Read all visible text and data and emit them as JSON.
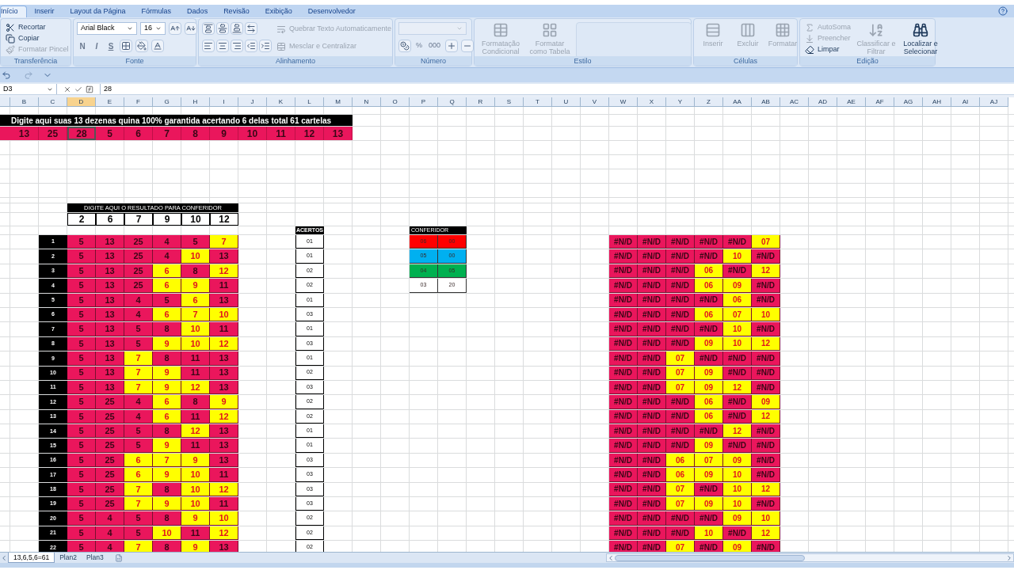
{
  "ribbon": {
    "tabs": [
      {
        "label": "Início",
        "selected": true
      },
      {
        "label": "Inserir",
        "selected": false
      },
      {
        "label": "Layout da Página",
        "selected": false
      },
      {
        "label": "Fórmulas",
        "selected": false
      },
      {
        "label": "Dados",
        "selected": false
      },
      {
        "label": "Revisão",
        "selected": false
      },
      {
        "label": "Exibição",
        "selected": false
      },
      {
        "label": "Desenvolvedor",
        "selected": false
      }
    ],
    "groups": [
      {
        "kind": "clipboard",
        "label": "Transferência",
        "items": [
          {
            "label": "Recortar",
            "disabled": false
          },
          {
            "label": "Copiar",
            "disabled": false
          },
          {
            "label": "Formatar Pincel",
            "disabled": true
          }
        ]
      },
      {
        "kind": "font",
        "label": "Fonte",
        "font": "Arial Black",
        "size": "16",
        "items": [
          {
            "label": "N",
            "disabled": true
          },
          {
            "label": "I",
            "disabled": true
          },
          {
            "label": "S",
            "disabled": true
          }
        ]
      },
      {
        "kind": "align",
        "label": "Alinhamento",
        "items": [
          {
            "label": "Quebrar Texto Automaticamente",
            "disabled": true
          },
          {
            "label": "Mesclar e Centralizar",
            "disabled": true
          }
        ]
      },
      {
        "kind": "number",
        "label": "Número",
        "items": [
          {
            "label": "%",
            "disabled": true
          },
          {
            "label": "000",
            "disabled": true
          }
        ]
      },
      {
        "kind": "style",
        "label": "Estilo",
        "items": [
          {
            "label": "Formatação Condicional",
            "disabled": true
          },
          {
            "label": "Formatar como Tabela",
            "disabled": true
          }
        ]
      },
      {
        "kind": "cells",
        "label": "Células",
        "items": [
          {
            "label": "Inserir",
            "disabled": true
          },
          {
            "label": "Excluir",
            "disabled": true
          },
          {
            "label": "Formatar",
            "disabled": true
          }
        ]
      },
      {
        "kind": "edit",
        "label": "Edição",
        "items": [
          {
            "label": "AutoSoma",
            "disabled": true
          },
          {
            "label": "Preencher",
            "disabled": true
          },
          {
            "label": "Limpar",
            "disabled": false
          },
          {
            "label": "Classificar e Filtrar",
            "disabled": true
          },
          {
            "label": "Localizar e Selecionar",
            "disabled": false
          }
        ]
      }
    ]
  },
  "formula_bar": {
    "name_box": "D3",
    "formula": "28"
  },
  "column_headers": [
    {
      "label": "B",
      "selected": false
    },
    {
      "label": "C",
      "selected": false
    },
    {
      "label": "D",
      "selected": true
    },
    {
      "label": "E",
      "selected": false
    },
    {
      "label": "F",
      "selected": false
    },
    {
      "label": "G",
      "selected": false
    },
    {
      "label": "H",
      "selected": false
    },
    {
      "label": "I",
      "selected": false
    },
    {
      "label": "J",
      "selected": false
    },
    {
      "label": "K",
      "selected": false
    },
    {
      "label": "L",
      "selected": false
    },
    {
      "label": "M",
      "selected": false
    },
    {
      "label": "N",
      "selected": false
    },
    {
      "label": "O",
      "selected": false
    },
    {
      "label": "P",
      "selected": false
    },
    {
      "label": "Q",
      "selected": false
    },
    {
      "label": "R",
      "selected": false
    },
    {
      "label": "S",
      "selected": false
    },
    {
      "label": "T",
      "selected": false
    },
    {
      "label": "U",
      "selected": false
    },
    {
      "label": "V",
      "selected": false
    },
    {
      "label": "W",
      "selected": false
    },
    {
      "label": "X",
      "selected": false
    },
    {
      "label": "Y",
      "selected": false
    },
    {
      "label": "Z",
      "selected": false
    },
    {
      "label": "AA",
      "selected": false
    },
    {
      "label": "AB",
      "selected": false
    },
    {
      "label": "AC",
      "selected": false
    },
    {
      "label": "AD",
      "selected": false
    },
    {
      "label": "AE",
      "selected": false
    },
    {
      "label": "AF",
      "selected": false
    },
    {
      "label": "AG",
      "selected": false
    },
    {
      "label": "AH",
      "selected": false
    },
    {
      "label": "AI",
      "selected": false
    },
    {
      "label": "AJ",
      "selected": false
    }
  ],
  "sheet": {
    "title": "Digite aqui suas 13 dezenas quina 100% garantida acertando 6 delas total 61 cartelas",
    "top_numbers": [
      {
        "value": "13",
        "selected": false
      },
      {
        "value": "25",
        "selected": false
      },
      {
        "value": "28",
        "selected": true
      },
      {
        "value": "5",
        "selected": false
      },
      {
        "value": "6",
        "selected": false
      },
      {
        "value": "7",
        "selected": false
      },
      {
        "value": "8",
        "selected": false
      },
      {
        "value": "9",
        "selected": false
      },
      {
        "value": "10",
        "selected": false
      },
      {
        "value": "11",
        "selected": false
      },
      {
        "value": "12",
        "selected": false
      },
      {
        "value": "13",
        "selected": false
      }
    ],
    "result_header": "DIGITE AQUI O RESULTADO PARA CONFERIDOR",
    "result_numbers": [
      "2",
      "6",
      "7",
      "9",
      "10",
      "12"
    ],
    "acertos_header": "ACERTOS",
    "conferidor": {
      "title": "CONFERIDOR",
      "rows": [
        {
          "values": [
            "06",
            "00"
          ],
          "color": "#ff0000"
        },
        {
          "values": [
            "05",
            "00"
          ],
          "color": "#00b0f0"
        },
        {
          "values": [
            "04",
            "05"
          ],
          "color": "#00b050"
        },
        {
          "values": [
            "03",
            "20"
          ],
          "color": "#ffffff"
        }
      ]
    },
    "rows": [
      {
        "index": "1",
        "acertos": "01",
        "cells": [
          {
            "value": "5",
            "hit": false
          },
          {
            "value": "13",
            "hit": false
          },
          {
            "value": "25",
            "hit": false
          },
          {
            "value": "4",
            "hit": false
          },
          {
            "value": "5",
            "hit": false
          },
          {
            "value": "7",
            "hit": true
          }
        ],
        "check": [
          {
            "value": "#N/D",
            "hit": false
          },
          {
            "value": "#N/D",
            "hit": false
          },
          {
            "value": "#N/D",
            "hit": false
          },
          {
            "value": "#N/D",
            "hit": false
          },
          {
            "value": "#N/D",
            "hit": false
          },
          {
            "value": "07",
            "hit": true
          }
        ]
      },
      {
        "index": "2",
        "acertos": "01",
        "cells": [
          {
            "value": "5",
            "hit": false
          },
          {
            "value": "13",
            "hit": false
          },
          {
            "value": "25",
            "hit": false
          },
          {
            "value": "4",
            "hit": false
          },
          {
            "value": "10",
            "hit": true
          },
          {
            "value": "13",
            "hit": false
          }
        ],
        "check": [
          {
            "value": "#N/D",
            "hit": false
          },
          {
            "value": "#N/D",
            "hit": false
          },
          {
            "value": "#N/D",
            "hit": false
          },
          {
            "value": "#N/D",
            "hit": false
          },
          {
            "value": "10",
            "hit": true
          },
          {
            "value": "#N/D",
            "hit": false
          }
        ]
      },
      {
        "index": "3",
        "acertos": "02",
        "cells": [
          {
            "value": "5",
            "hit": false
          },
          {
            "value": "13",
            "hit": false
          },
          {
            "value": "25",
            "hit": false
          },
          {
            "value": "6",
            "hit": true
          },
          {
            "value": "8",
            "hit": false
          },
          {
            "value": "12",
            "hit": true
          }
        ],
        "check": [
          {
            "value": "#N/D",
            "hit": false
          },
          {
            "value": "#N/D",
            "hit": false
          },
          {
            "value": "#N/D",
            "hit": false
          },
          {
            "value": "06",
            "hit": true
          },
          {
            "value": "#N/D",
            "hit": false
          },
          {
            "value": "12",
            "hit": true
          }
        ]
      },
      {
        "index": "4",
        "acertos": "02",
        "cells": [
          {
            "value": "5",
            "hit": false
          },
          {
            "value": "13",
            "hit": false
          },
          {
            "value": "25",
            "hit": false
          },
          {
            "value": "6",
            "hit": true
          },
          {
            "value": "9",
            "hit": true
          },
          {
            "value": "11",
            "hit": false
          }
        ],
        "check": [
          {
            "value": "#N/D",
            "hit": false
          },
          {
            "value": "#N/D",
            "hit": false
          },
          {
            "value": "#N/D",
            "hit": false
          },
          {
            "value": "06",
            "hit": true
          },
          {
            "value": "09",
            "hit": true
          },
          {
            "value": "#N/D",
            "hit": false
          }
        ]
      },
      {
        "index": "5",
        "acertos": "01",
        "cells": [
          {
            "value": "5",
            "hit": false
          },
          {
            "value": "13",
            "hit": false
          },
          {
            "value": "4",
            "hit": false
          },
          {
            "value": "5",
            "hit": false
          },
          {
            "value": "6",
            "hit": true
          },
          {
            "value": "13",
            "hit": false
          }
        ],
        "check": [
          {
            "value": "#N/D",
            "hit": false
          },
          {
            "value": "#N/D",
            "hit": false
          },
          {
            "value": "#N/D",
            "hit": false
          },
          {
            "value": "#N/D",
            "hit": false
          },
          {
            "value": "06",
            "hit": true
          },
          {
            "value": "#N/D",
            "hit": false
          }
        ]
      },
      {
        "index": "6",
        "acertos": "03",
        "cells": [
          {
            "value": "5",
            "hit": false
          },
          {
            "value": "13",
            "hit": false
          },
          {
            "value": "4",
            "hit": false
          },
          {
            "value": "6",
            "hit": true
          },
          {
            "value": "7",
            "hit": true
          },
          {
            "value": "10",
            "hit": true
          }
        ],
        "check": [
          {
            "value": "#N/D",
            "hit": false
          },
          {
            "value": "#N/D",
            "hit": false
          },
          {
            "value": "#N/D",
            "hit": false
          },
          {
            "value": "06",
            "hit": true
          },
          {
            "value": "07",
            "hit": true
          },
          {
            "value": "10",
            "hit": true
          }
        ]
      },
      {
        "index": "7",
        "acertos": "01",
        "cells": [
          {
            "value": "5",
            "hit": false
          },
          {
            "value": "13",
            "hit": false
          },
          {
            "value": "5",
            "hit": false
          },
          {
            "value": "8",
            "hit": false
          },
          {
            "value": "10",
            "hit": true
          },
          {
            "value": "11",
            "hit": false
          }
        ],
        "check": [
          {
            "value": "#N/D",
            "hit": false
          },
          {
            "value": "#N/D",
            "hit": false
          },
          {
            "value": "#N/D",
            "hit": false
          },
          {
            "value": "#N/D",
            "hit": false
          },
          {
            "value": "10",
            "hit": true
          },
          {
            "value": "#N/D",
            "hit": false
          }
        ]
      },
      {
        "index": "8",
        "acertos": "03",
        "cells": [
          {
            "value": "5",
            "hit": false
          },
          {
            "value": "13",
            "hit": false
          },
          {
            "value": "5",
            "hit": false
          },
          {
            "value": "9",
            "hit": true
          },
          {
            "value": "10",
            "hit": true
          },
          {
            "value": "12",
            "hit": true
          }
        ],
        "check": [
          {
            "value": "#N/D",
            "hit": false
          },
          {
            "value": "#N/D",
            "hit": false
          },
          {
            "value": "#N/D",
            "hit": false
          },
          {
            "value": "09",
            "hit": true
          },
          {
            "value": "10",
            "hit": true
          },
          {
            "value": "12",
            "hit": true
          }
        ]
      },
      {
        "index": "9",
        "acertos": "01",
        "cells": [
          {
            "value": "5",
            "hit": false
          },
          {
            "value": "13",
            "hit": false
          },
          {
            "value": "7",
            "hit": true
          },
          {
            "value": "8",
            "hit": false
          },
          {
            "value": "11",
            "hit": false
          },
          {
            "value": "13",
            "hit": false
          }
        ],
        "check": [
          {
            "value": "#N/D",
            "hit": false
          },
          {
            "value": "#N/D",
            "hit": false
          },
          {
            "value": "07",
            "hit": true
          },
          {
            "value": "#N/D",
            "hit": false
          },
          {
            "value": "#N/D",
            "hit": false
          },
          {
            "value": "#N/D",
            "hit": false
          }
        ]
      },
      {
        "index": "10",
        "acertos": "02",
        "cells": [
          {
            "value": "5",
            "hit": false
          },
          {
            "value": "13",
            "hit": false
          },
          {
            "value": "7",
            "hit": true
          },
          {
            "value": "9",
            "hit": true
          },
          {
            "value": "11",
            "hit": false
          },
          {
            "value": "13",
            "hit": false
          }
        ],
        "check": [
          {
            "value": "#N/D",
            "hit": false
          },
          {
            "value": "#N/D",
            "hit": false
          },
          {
            "value": "07",
            "hit": true
          },
          {
            "value": "09",
            "hit": true
          },
          {
            "value": "#N/D",
            "hit": false
          },
          {
            "value": "#N/D",
            "hit": false
          }
        ]
      },
      {
        "index": "11",
        "acertos": "03",
        "cells": [
          {
            "value": "5",
            "hit": false
          },
          {
            "value": "13",
            "hit": false
          },
          {
            "value": "7",
            "hit": true
          },
          {
            "value": "9",
            "hit": true
          },
          {
            "value": "12",
            "hit": true
          },
          {
            "value": "13",
            "hit": false
          }
        ],
        "check": [
          {
            "value": "#N/D",
            "hit": false
          },
          {
            "value": "#N/D",
            "hit": false
          },
          {
            "value": "07",
            "hit": true
          },
          {
            "value": "09",
            "hit": true
          },
          {
            "value": "12",
            "hit": true
          },
          {
            "value": "#N/D",
            "hit": false
          }
        ]
      },
      {
        "index": "12",
        "acertos": "02",
        "cells": [
          {
            "value": "5",
            "hit": false
          },
          {
            "value": "25",
            "hit": false
          },
          {
            "value": "4",
            "hit": false
          },
          {
            "value": "6",
            "hit": true
          },
          {
            "value": "8",
            "hit": false
          },
          {
            "value": "9",
            "hit": true
          }
        ],
        "check": [
          {
            "value": "#N/D",
            "hit": false
          },
          {
            "value": "#N/D",
            "hit": false
          },
          {
            "value": "#N/D",
            "hit": false
          },
          {
            "value": "06",
            "hit": true
          },
          {
            "value": "#N/D",
            "hit": false
          },
          {
            "value": "09",
            "hit": true
          }
        ]
      },
      {
        "index": "13",
        "acertos": "02",
        "cells": [
          {
            "value": "5",
            "hit": false
          },
          {
            "value": "25",
            "hit": false
          },
          {
            "value": "4",
            "hit": false
          },
          {
            "value": "6",
            "hit": true
          },
          {
            "value": "11",
            "hit": false
          },
          {
            "value": "12",
            "hit": true
          }
        ],
        "check": [
          {
            "value": "#N/D",
            "hit": false
          },
          {
            "value": "#N/D",
            "hit": false
          },
          {
            "value": "#N/D",
            "hit": false
          },
          {
            "value": "06",
            "hit": true
          },
          {
            "value": "#N/D",
            "hit": false
          },
          {
            "value": "12",
            "hit": true
          }
        ]
      },
      {
        "index": "14",
        "acertos": "01",
        "cells": [
          {
            "value": "5",
            "hit": false
          },
          {
            "value": "25",
            "hit": false
          },
          {
            "value": "5",
            "hit": false
          },
          {
            "value": "8",
            "hit": false
          },
          {
            "value": "12",
            "hit": true
          },
          {
            "value": "13",
            "hit": false
          }
        ],
        "check": [
          {
            "value": "#N/D",
            "hit": false
          },
          {
            "value": "#N/D",
            "hit": false
          },
          {
            "value": "#N/D",
            "hit": false
          },
          {
            "value": "#N/D",
            "hit": false
          },
          {
            "value": "12",
            "hit": true
          },
          {
            "value": "#N/D",
            "hit": false
          }
        ]
      },
      {
        "index": "15",
        "acertos": "01",
        "cells": [
          {
            "value": "5",
            "hit": false
          },
          {
            "value": "25",
            "hit": false
          },
          {
            "value": "5",
            "hit": false
          },
          {
            "value": "9",
            "hit": true
          },
          {
            "value": "11",
            "hit": false
          },
          {
            "value": "13",
            "hit": false
          }
        ],
        "check": [
          {
            "value": "#N/D",
            "hit": false
          },
          {
            "value": "#N/D",
            "hit": false
          },
          {
            "value": "#N/D",
            "hit": false
          },
          {
            "value": "09",
            "hit": true
          },
          {
            "value": "#N/D",
            "hit": false
          },
          {
            "value": "#N/D",
            "hit": false
          }
        ]
      },
      {
        "index": "16",
        "acertos": "03",
        "cells": [
          {
            "value": "5",
            "hit": false
          },
          {
            "value": "25",
            "hit": false
          },
          {
            "value": "6",
            "hit": true
          },
          {
            "value": "7",
            "hit": true
          },
          {
            "value": "9",
            "hit": true
          },
          {
            "value": "13",
            "hit": false
          }
        ],
        "check": [
          {
            "value": "#N/D",
            "hit": false
          },
          {
            "value": "#N/D",
            "hit": false
          },
          {
            "value": "06",
            "hit": true
          },
          {
            "value": "07",
            "hit": true
          },
          {
            "value": "09",
            "hit": true
          },
          {
            "value": "#N/D",
            "hit": false
          }
        ]
      },
      {
        "index": "17",
        "acertos": "03",
        "cells": [
          {
            "value": "5",
            "hit": false
          },
          {
            "value": "25",
            "hit": false
          },
          {
            "value": "6",
            "hit": true
          },
          {
            "value": "9",
            "hit": true
          },
          {
            "value": "10",
            "hit": true
          },
          {
            "value": "11",
            "hit": false
          }
        ],
        "check": [
          {
            "value": "#N/D",
            "hit": false
          },
          {
            "value": "#N/D",
            "hit": false
          },
          {
            "value": "06",
            "hit": true
          },
          {
            "value": "09",
            "hit": true
          },
          {
            "value": "10",
            "hit": true
          },
          {
            "value": "#N/D",
            "hit": false
          }
        ]
      },
      {
        "index": "18",
        "acertos": "03",
        "cells": [
          {
            "value": "5",
            "hit": false
          },
          {
            "value": "25",
            "hit": false
          },
          {
            "value": "7",
            "hit": true
          },
          {
            "value": "8",
            "hit": false
          },
          {
            "value": "10",
            "hit": true
          },
          {
            "value": "12",
            "hit": true
          }
        ],
        "check": [
          {
            "value": "#N/D",
            "hit": false
          },
          {
            "value": "#N/D",
            "hit": false
          },
          {
            "value": "07",
            "hit": true
          },
          {
            "value": "#N/D",
            "hit": false
          },
          {
            "value": "10",
            "hit": true
          },
          {
            "value": "12",
            "hit": true
          }
        ]
      },
      {
        "index": "19",
        "acertos": "03",
        "cells": [
          {
            "value": "5",
            "hit": false
          },
          {
            "value": "25",
            "hit": false
          },
          {
            "value": "7",
            "hit": true
          },
          {
            "value": "9",
            "hit": true
          },
          {
            "value": "10",
            "hit": true
          },
          {
            "value": "11",
            "hit": false
          }
        ],
        "check": [
          {
            "value": "#N/D",
            "hit": false
          },
          {
            "value": "#N/D",
            "hit": false
          },
          {
            "value": "07",
            "hit": true
          },
          {
            "value": "09",
            "hit": true
          },
          {
            "value": "10",
            "hit": true
          },
          {
            "value": "#N/D",
            "hit": false
          }
        ]
      },
      {
        "index": "20",
        "acertos": "02",
        "cells": [
          {
            "value": "5",
            "hit": false
          },
          {
            "value": "4",
            "hit": false
          },
          {
            "value": "5",
            "hit": false
          },
          {
            "value": "8",
            "hit": false
          },
          {
            "value": "9",
            "hit": true
          },
          {
            "value": "10",
            "hit": true
          }
        ],
        "check": [
          {
            "value": "#N/D",
            "hit": false
          },
          {
            "value": "#N/D",
            "hit": false
          },
          {
            "value": "#N/D",
            "hit": false
          },
          {
            "value": "#N/D",
            "hit": false
          },
          {
            "value": "09",
            "hit": true
          },
          {
            "value": "10",
            "hit": true
          }
        ]
      },
      {
        "index": "21",
        "acertos": "02",
        "cells": [
          {
            "value": "5",
            "hit": false
          },
          {
            "value": "4",
            "hit": false
          },
          {
            "value": "5",
            "hit": false
          },
          {
            "value": "10",
            "hit": true
          },
          {
            "value": "11",
            "hit": false
          },
          {
            "value": "12",
            "hit": true
          }
        ],
        "check": [
          {
            "value": "#N/D",
            "hit": false
          },
          {
            "value": "#N/D",
            "hit": false
          },
          {
            "value": "#N/D",
            "hit": false
          },
          {
            "value": "10",
            "hit": true
          },
          {
            "value": "#N/D",
            "hit": false
          },
          {
            "value": "12",
            "hit": true
          }
        ]
      },
      {
        "index": "22",
        "acertos": "02",
        "cells": [
          {
            "value": "5",
            "hit": false
          },
          {
            "value": "4",
            "hit": false
          },
          {
            "value": "7",
            "hit": true
          },
          {
            "value": "8",
            "hit": false
          },
          {
            "value": "9",
            "hit": true
          },
          {
            "value": "13",
            "hit": false
          }
        ],
        "check": [
          {
            "value": "#N/D",
            "hit": false
          },
          {
            "value": "#N/D",
            "hit": false
          },
          {
            "value": "07",
            "hit": true
          },
          {
            "value": "#N/D",
            "hit": false
          },
          {
            "value": "09",
            "hit": true
          },
          {
            "value": "#N/D",
            "hit": false
          }
        ]
      }
    ]
  },
  "sheet_tabs": [
    {
      "label": "13,6,5,6=61",
      "selected": true
    },
    {
      "label": "Plan2",
      "selected": false
    },
    {
      "label": "Plan3",
      "selected": false
    }
  ]
}
